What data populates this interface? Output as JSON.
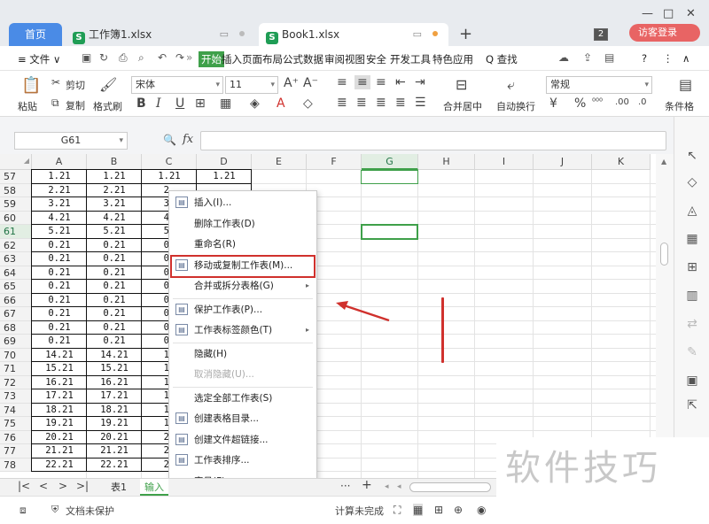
{
  "window": {
    "min": "—",
    "max": "□",
    "close": "✕"
  },
  "tabs": {
    "home": "首页",
    "workbook1": "工作簿1.xlsx",
    "book1": "Book1.xlsx",
    "new_tab": "+",
    "tab_count": "2",
    "login": "访客登录"
  },
  "menubar": {
    "file": "≡ 文件 ∨",
    "start": "开始",
    "items": [
      "插入",
      "页面布局",
      "公式",
      "数据",
      "审阅",
      "视图",
      "安全",
      "开发工具",
      "特色应用"
    ],
    "search": "Q 查找",
    "help": "?",
    "more": "⋮",
    "collapse": "∧"
  },
  "ribbon": {
    "paste": "粘贴",
    "cut": "剪切",
    "copy": "复制",
    "format_painter": "格式刷",
    "font_name": "宋体",
    "font_size": "11",
    "bold": "B",
    "italic": "I",
    "underline": "U",
    "merge_center": "合并居中",
    "auto_wrap": "自动换行",
    "number_format": "常规",
    "conditional_format": "条件格"
  },
  "formula": {
    "name_box": "G61",
    "fx": "fx",
    "value": ""
  },
  "grid": {
    "columns": [
      "A",
      "B",
      "C",
      "D",
      "E",
      "F",
      "G",
      "H",
      "I",
      "J",
      "K"
    ],
    "selected_column": "G",
    "rows": [
      "57",
      "58",
      "59",
      "60",
      "61",
      "62",
      "63",
      "64",
      "65",
      "66",
      "67",
      "68",
      "69",
      "70",
      "71",
      "72",
      "73",
      "74",
      "75",
      "76",
      "77",
      "78"
    ],
    "selected_row": "61",
    "col_a": [
      "1.21",
      "2.21",
      "3.21",
      "4.21",
      "5.21",
      "0.21",
      "0.21",
      "0.21",
      "0.21",
      "0.21",
      "0.21",
      "0.21",
      "0.21",
      "14.21",
      "15.21",
      "16.21",
      "17.21",
      "18.21",
      "19.21",
      "20.21",
      "21.21",
      "22.21"
    ],
    "col_b": [
      "1.21",
      "2.21",
      "3.21",
      "4.21",
      "5.21",
      "0.21",
      "0.21",
      "0.21",
      "0.21",
      "0.21",
      "0.21",
      "0.21",
      "0.21",
      "14.21",
      "15.21",
      "16.21",
      "17.21",
      "18.21",
      "19.21",
      "20.21",
      "21.21",
      "22.21"
    ],
    "col_c": [
      "1.21",
      "2.",
      "3.",
      "4.",
      "5.",
      "0.",
      "0.",
      "0.",
      "0.",
      "0.",
      "0.",
      "0.",
      "0.",
      "14",
      "15",
      "16",
      "17",
      "18",
      "19",
      "20",
      "21",
      "22"
    ],
    "col_d": [
      "1.21"
    ]
  },
  "context_menu": {
    "items": [
      {
        "label": "插入(I)...",
        "icon": "insert-sheet-icon",
        "has_sub": false,
        "disabled": false
      },
      {
        "label": "删除工作表(D)",
        "icon": "",
        "has_sub": false,
        "disabled": false
      },
      {
        "label": "重命名(R)",
        "icon": "",
        "has_sub": false,
        "disabled": false
      },
      {
        "label": "移动或复制工作表(M)...",
        "icon": "move-copy-sheet-icon",
        "has_sub": false,
        "disabled": false
      },
      {
        "label": "合并或拆分表格(G)",
        "icon": "",
        "has_sub": true,
        "disabled": false
      },
      {
        "label": "保护工作表(P)...",
        "icon": "protect-sheet-icon",
        "has_sub": false,
        "disabled": false
      },
      {
        "label": "工作表标签颜色(T)",
        "icon": "tab-color-icon",
        "has_sub": true,
        "disabled": false
      },
      {
        "label": "隐藏(H)",
        "icon": "",
        "has_sub": false,
        "disabled": false
      },
      {
        "label": "取消隐藏(U)...",
        "icon": "",
        "has_sub": false,
        "disabled": true
      },
      {
        "label": "选定全部工作表(S)",
        "icon": "",
        "has_sub": false,
        "disabled": false
      },
      {
        "label": "创建表格目录...",
        "icon": "table-directory-icon",
        "has_sub": false,
        "disabled": false
      },
      {
        "label": "创建文件超链接...",
        "icon": "file-hyperlink-icon",
        "has_sub": false,
        "disabled": false
      },
      {
        "label": "工作表排序...",
        "icon": "sheet-sort-icon",
        "has_sub": false,
        "disabled": false
      },
      {
        "label": "字号(F)",
        "icon": "",
        "has_sub": true,
        "disabled": false
      }
    ],
    "submenu_arrow": "▸"
  },
  "sheet_tabs": {
    "nav": [
      "|<",
      "<",
      ">",
      ">|"
    ],
    "tabs": [
      "表1",
      "输入"
    ],
    "more": "···",
    "add": "+"
  },
  "status": {
    "doc_protect": "文档未保护",
    "calc": "计算未完成"
  },
  "watermark": "软件技巧",
  "colors": {
    "accent": "#3fa04a",
    "highlight": "#d0312d",
    "tab_blue": "#4a8be6"
  }
}
